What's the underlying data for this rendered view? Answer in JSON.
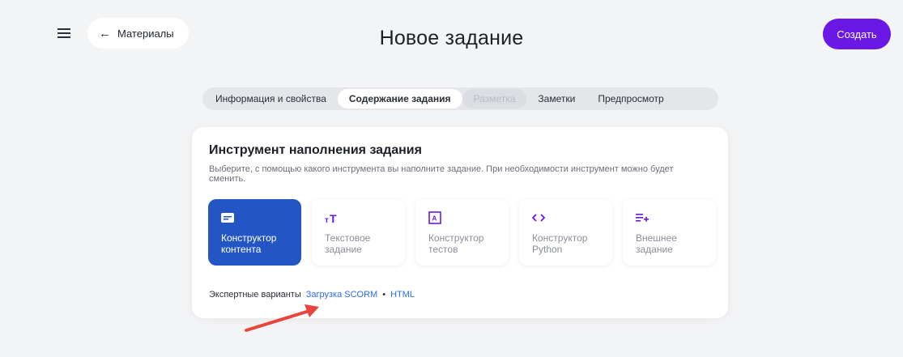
{
  "header": {
    "back_label": "Материалы",
    "title": "Новое задание",
    "create_label": "Создать"
  },
  "tabs": [
    {
      "label": "Информация и свойства",
      "state": "normal"
    },
    {
      "label": "Содержание задания",
      "state": "active"
    },
    {
      "label": "Разметка",
      "state": "disabled"
    },
    {
      "label": "Заметки",
      "state": "normal"
    },
    {
      "label": "Предпросмотр",
      "state": "normal"
    }
  ],
  "card": {
    "title": "Инструмент наполнения задания",
    "description": "Выберите, с помощью какого инструмента вы наполните задание. При необходимости инструмент можно будет сменить."
  },
  "tools": [
    {
      "icon": "content-builder-icon",
      "line1": "Конструктор",
      "line2": "контента",
      "selected": true
    },
    {
      "icon": "text-icon",
      "line1": "Текстовое",
      "line2": "задание",
      "selected": false
    },
    {
      "icon": "test-builder-icon",
      "line1": "Конструктор",
      "line2": "тестов",
      "selected": false
    },
    {
      "icon": "code-icon",
      "line1": "Конструктор",
      "line2": "Python",
      "selected": false
    },
    {
      "icon": "external-task-icon",
      "line1": "Внешнее",
      "line2": "задание",
      "selected": false
    }
  ],
  "expert": {
    "label": "Экспертные варианты",
    "link_scorm": "Загрузка SCORM",
    "separator": "•",
    "link_html": "HTML"
  },
  "colors": {
    "accent": "#6b17e6",
    "selected_tool": "#2356c4",
    "link": "#2a6df4",
    "annotation_arrow": "#e8453c"
  }
}
